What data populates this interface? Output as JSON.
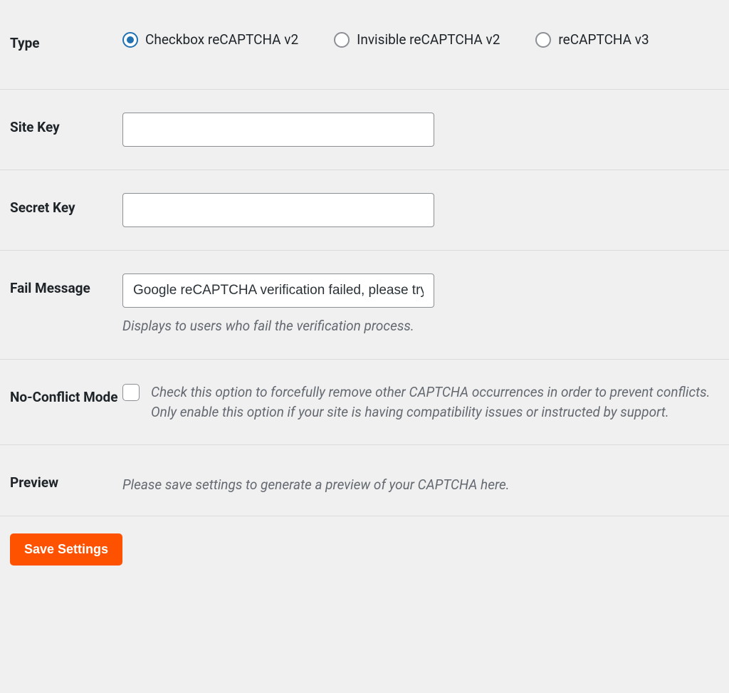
{
  "fields": {
    "type": {
      "label": "Type",
      "options": [
        {
          "label": "Checkbox reCAPTCHA v2",
          "selected": true
        },
        {
          "label": "Invisible reCAPTCHA v2",
          "selected": false
        },
        {
          "label": "reCAPTCHA v3",
          "selected": false
        }
      ]
    },
    "site_key": {
      "label": "Site Key",
      "value": ""
    },
    "secret_key": {
      "label": "Secret Key",
      "value": ""
    },
    "fail_message": {
      "label": "Fail Message",
      "value": "Google reCAPTCHA verification failed, please try again later.",
      "description": "Displays to users who fail the verification process."
    },
    "no_conflict": {
      "label": "No-Conflict Mode",
      "checked": false,
      "description": "Check this option to forcefully remove other CAPTCHA occurrences in order to prevent conflicts. Only enable this option if your site is having compatibility issues or instructed by support."
    },
    "preview": {
      "label": "Preview",
      "text": "Please save settings to generate a preview of your CAPTCHA here."
    }
  },
  "actions": {
    "save": "Save Settings"
  }
}
